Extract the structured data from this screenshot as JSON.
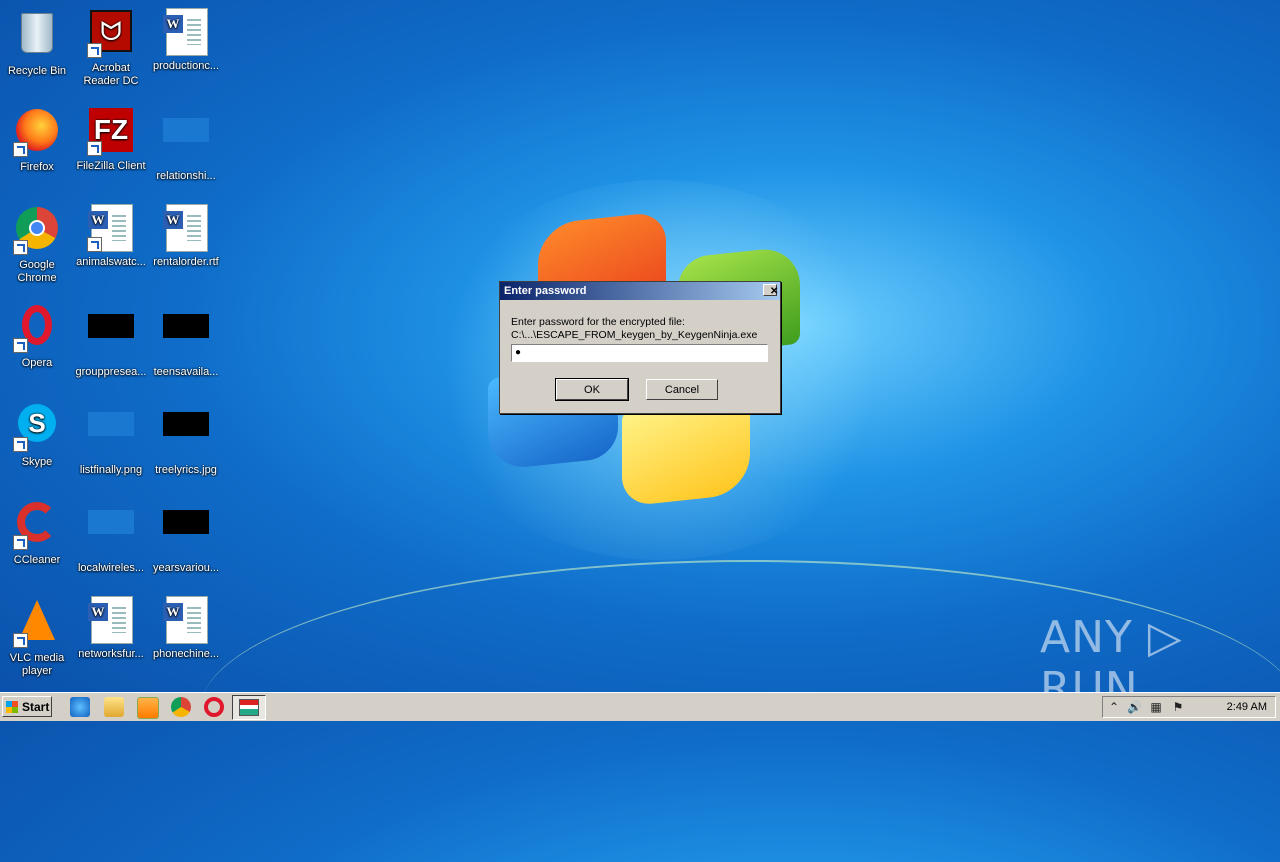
{
  "desktop": {
    "icons": [
      {
        "label": "Recycle Bin",
        "name": "recycle-bin"
      },
      {
        "label": "Acrobat Reader DC",
        "name": "acrobat-reader"
      },
      {
        "label": "productionc...",
        "name": "production-doc"
      },
      {
        "label": "Firefox",
        "name": "firefox"
      },
      {
        "label": "FileZilla Client",
        "name": "filezilla"
      },
      {
        "label": "relationshi...",
        "name": "relationship-file"
      },
      {
        "label": "Google Chrome",
        "name": "chrome"
      },
      {
        "label": "animalswatc...",
        "name": "animals-doc"
      },
      {
        "label": "rentalorder.rtf",
        "name": "rentalorder-doc"
      },
      {
        "label": "Opera",
        "name": "opera"
      },
      {
        "label": "grouppresea...",
        "name": "grouppresea-img"
      },
      {
        "label": "teensavaila...",
        "name": "teensavaila-img"
      },
      {
        "label": "Skype",
        "name": "skype"
      },
      {
        "label": "listfinally.png",
        "name": "listfinally-img"
      },
      {
        "label": "treelyrics.jpg",
        "name": "treelyrics-img"
      },
      {
        "label": "CCleaner",
        "name": "ccleaner"
      },
      {
        "label": "localwireles...",
        "name": "localwireles-img"
      },
      {
        "label": "yearsvariou...",
        "name": "yearsvariou-img"
      },
      {
        "label": "VLC media player",
        "name": "vlc"
      },
      {
        "label": "networksfur...",
        "name": "networksfur-doc"
      },
      {
        "label": "phonechine...",
        "name": "phonechine-doc"
      }
    ]
  },
  "dialog": {
    "title": "Enter password",
    "close_glyph": "✕",
    "prompt_line1": "Enter password for the encrypted file:",
    "prompt_line2": "C:\\...\\ESCAPE_FROM_keygen_by_KeygenNinja.exe",
    "password_value": "●",
    "ok_label": "OK",
    "cancel_label": "Cancel"
  },
  "taskbar": {
    "start_label": "Start",
    "clock": "2:49 AM",
    "tray_up_glyph": "⌃",
    "tray_volume_glyph": "🔊",
    "tray_network_glyph": "▦",
    "tray_flag_glyph": "⚑"
  },
  "watermark": "ANY ▷ RUN",
  "colors": {
    "title_bar": "#0a246a",
    "dialog_bg": "#d4d0c8",
    "taskbar_bg": "#d4d0c8"
  }
}
